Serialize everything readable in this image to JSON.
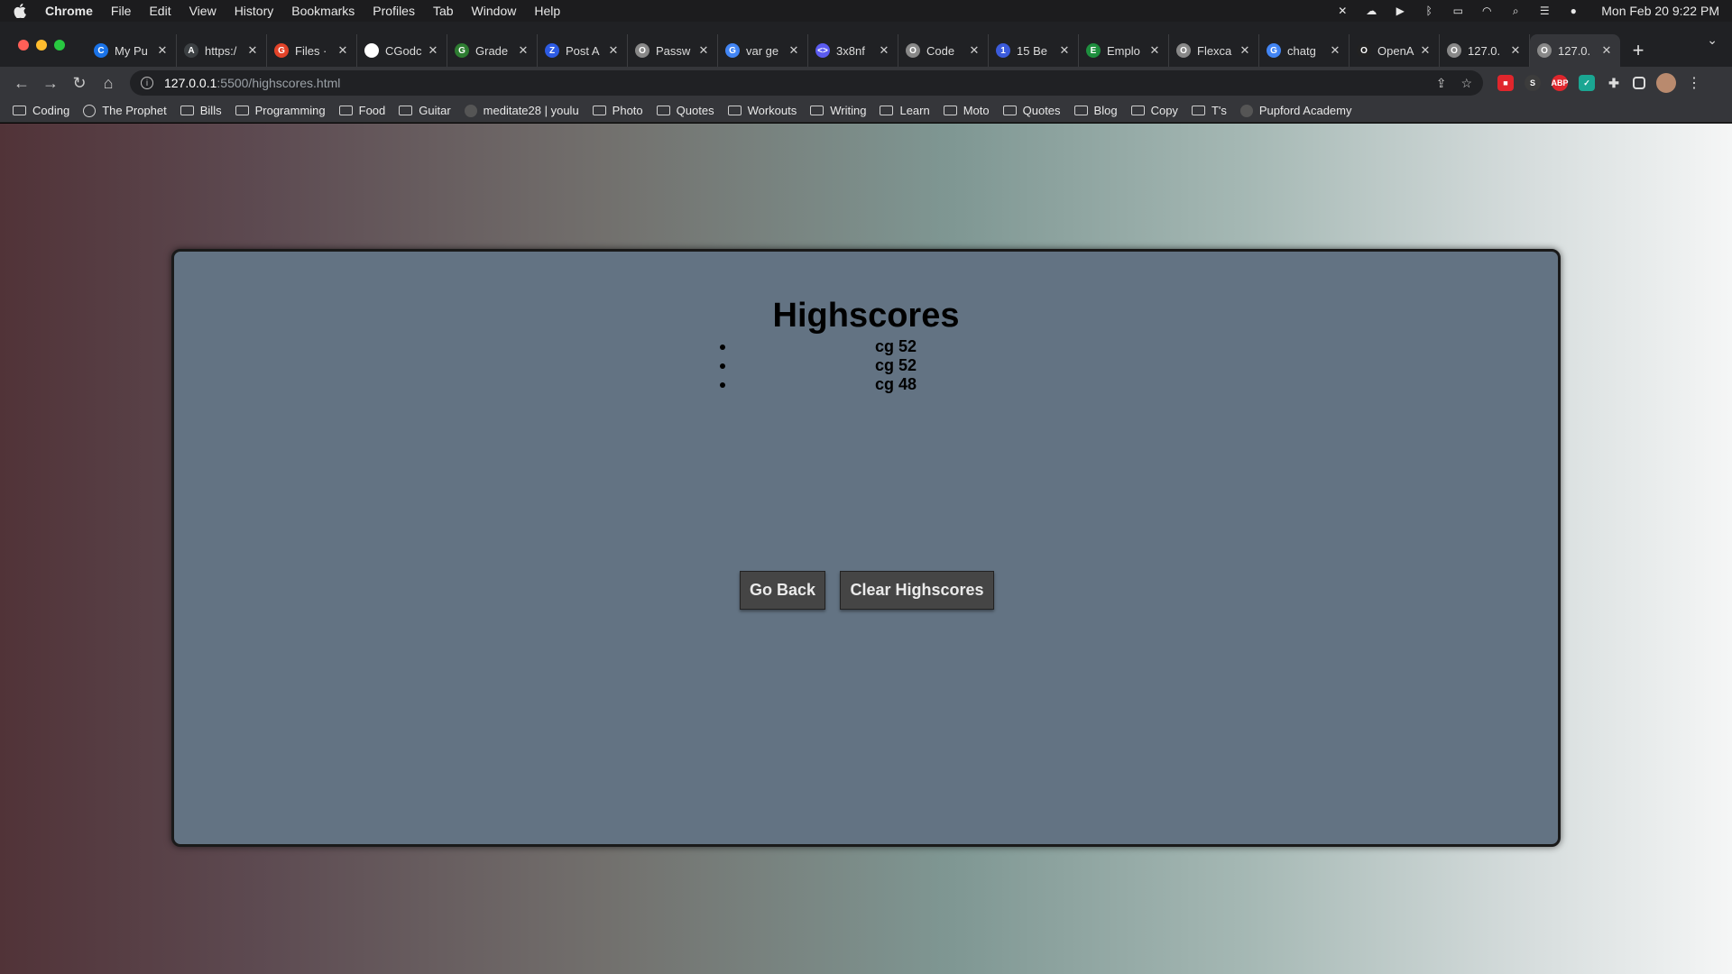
{
  "menubar": {
    "app_name": "Chrome",
    "items": [
      "File",
      "Edit",
      "View",
      "History",
      "Bookmarks",
      "Profiles",
      "Tab",
      "Window",
      "Help"
    ],
    "clock": "Mon Feb 20  9:22 PM"
  },
  "tabs": [
    {
      "title": "My Pu",
      "favicon_color": "#1a73e8",
      "favicon_text": "C"
    },
    {
      "title": "https:/",
      "favicon_color": "#3c4043",
      "favicon_text": "A"
    },
    {
      "title": "Files ·",
      "favicon_color": "#e24329",
      "favicon_text": "G"
    },
    {
      "title": "CGodc",
      "favicon_color": "#ffffff",
      "favicon_text": "G"
    },
    {
      "title": "Grade",
      "favicon_color": "#2e7d32",
      "favicon_text": "G"
    },
    {
      "title": "Post A",
      "favicon_color": "#2d5be3",
      "favicon_text": "Z"
    },
    {
      "title": "Passw",
      "favicon_color": "#888888",
      "favicon_text": "O"
    },
    {
      "title": "var ge",
      "favicon_color": "#4285f4",
      "favicon_text": "G"
    },
    {
      "title": "3x8nf",
      "favicon_color": "#5b5bf0",
      "favicon_text": "<>"
    },
    {
      "title": "Code",
      "favicon_color": "#888888",
      "favicon_text": "O"
    },
    {
      "title": "15 Be",
      "favicon_color": "#3b5bdb",
      "favicon_text": "1"
    },
    {
      "title": "Emplo",
      "favicon_color": "#1e8e3e",
      "favicon_text": "E"
    },
    {
      "title": "Flexca",
      "favicon_color": "#888888",
      "favicon_text": "O"
    },
    {
      "title": "chatg",
      "favicon_color": "#4285f4",
      "favicon_text": "G"
    },
    {
      "title": "OpenA",
      "favicon_color": "#222222",
      "favicon_text": "O"
    },
    {
      "title": "127.0.",
      "favicon_color": "#888888",
      "favicon_text": "O"
    },
    {
      "title": "127.0.",
      "favicon_color": "#888888",
      "favicon_text": "O",
      "active": true
    }
  ],
  "toolbar": {
    "url_host": "127.0.0.1",
    "url_path": ":5500/highscores.html"
  },
  "bookmarks": [
    {
      "label": "Coding",
      "type": "folder"
    },
    {
      "label": "The Prophet",
      "type": "globe"
    },
    {
      "label": "Bills",
      "type": "folder"
    },
    {
      "label": "Programming",
      "type": "folder"
    },
    {
      "label": "Food",
      "type": "folder"
    },
    {
      "label": "Guitar",
      "type": "folder"
    },
    {
      "label": "meditate28 | youlu",
      "type": "site"
    },
    {
      "label": "Photo",
      "type": "folder"
    },
    {
      "label": "Quotes",
      "type": "folder"
    },
    {
      "label": "Workouts",
      "type": "folder"
    },
    {
      "label": "Writing",
      "type": "folder"
    },
    {
      "label": "Learn",
      "type": "folder"
    },
    {
      "label": "Moto",
      "type": "folder"
    },
    {
      "label": "Quotes",
      "type": "folder"
    },
    {
      "label": "Blog",
      "type": "folder"
    },
    {
      "label": "Copy",
      "type": "folder"
    },
    {
      "label": "T's",
      "type": "folder"
    },
    {
      "label": "Pupford Academy",
      "type": "site"
    }
  ],
  "page": {
    "title": "Highscores",
    "scores": [
      "cg 52",
      "cg 52",
      "cg 48"
    ],
    "go_back_label": "Go Back",
    "clear_label": "Clear Highscores"
  }
}
